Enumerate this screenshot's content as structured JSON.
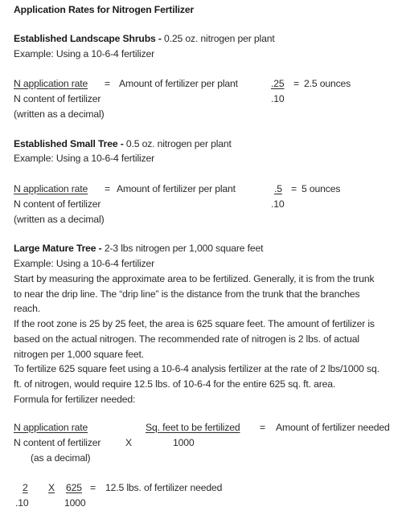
{
  "title": "Application Rates for Nitrogen Fertilizer",
  "shrubs": {
    "heading": "Established Landscape Shrubs -",
    "rate": " 0.25 oz. nitrogen per plant",
    "example": "Example: Using a 10-6-4 fertilizer",
    "formula": {
      "numerator": "N application rate",
      "equals": "=",
      "result_label": "Amount of fertilizer per plant",
      "denominator": "N content of fertilizer",
      "note": "(written as a decimal)",
      "calc_numerator": ".25",
      "calc_equals": "=",
      "calc_result": "2.5 ounces",
      "calc_denominator": ".10"
    }
  },
  "small_tree": {
    "heading": "Established Small Tree -",
    "rate": " 0.5 oz. nitrogen per plant",
    "example": "Example: Using a 10-6-4 fertilizer",
    "formula": {
      "numerator": "N application rate",
      "equals": "=",
      "result_label": "Amount of fertilizer per plant",
      "denominator": "N content of fertilizer",
      "note": "(written as a decimal)",
      "calc_numerator": ".5",
      "calc_equals": "=",
      "calc_result": "5 ounces",
      "calc_denominator": ".10"
    }
  },
  "large_tree": {
    "heading": "Large Mature Tree -",
    "rate": " 2-3 lbs nitrogen per 1,000 square feet",
    "example": "Example: Using a 10-6-4 fertilizer",
    "paragraph_lines": [
      "Start by measuring the approximate area to be fertilized. Generally, it is from the trunk",
      "to near the drip line. The “drip line” is the distance from the trunk that the branches",
      "reach.",
      "If the root zone is 25 by 25 feet, the area is 625 square feet. The amount of fertilizer is",
      "based on the actual nitrogen. The recommended rate of nitrogen is 2 lbs. of actual",
      "nitrogen per 1,000 square feet.",
      "To fertilize 625 square feet using a 10-6-4 analysis fertilizer at the rate of 2 lbs/1000 sq.",
      "ft. of nitrogen, would require 12.5 lbs. of 10-6-4 for the entire 625 sq. ft. area.",
      "Formula for fertilizer needed:"
    ],
    "formula": {
      "numerator": "N application rate",
      "denominator": "N content of fertilizer",
      "note": "(as a decimal)",
      "times": "X",
      "sq_numerator": "Sq. feet to be fertilized",
      "sq_denominator": "1000",
      "equals": "=",
      "result_label": "Amount of fertilizer needed"
    },
    "calculation": {
      "n_numerator": "2",
      "n_denominator": ".10",
      "times": "X",
      "sq_numerator": "625",
      "sq_denominator": "1000",
      "equals": "=",
      "result": "12.5 lbs. of fertilizer needed"
    }
  }
}
